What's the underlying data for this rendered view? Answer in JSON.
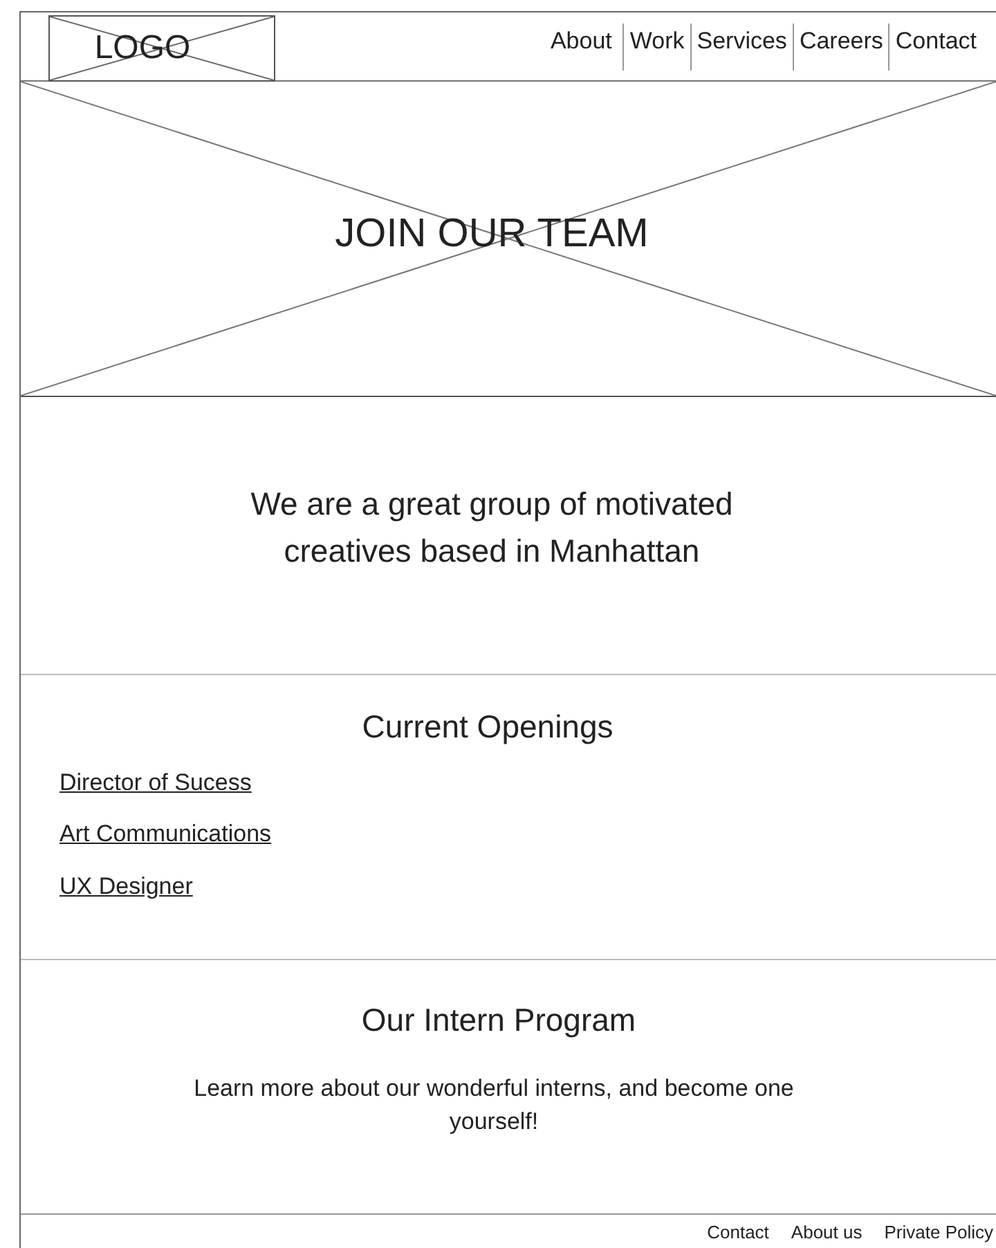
{
  "header": {
    "logo": "LOGO",
    "nav": [
      "About",
      "Work",
      "Services",
      "Careers",
      "Contact"
    ]
  },
  "hero": {
    "title": "JOIN OUR TEAM"
  },
  "intro": {
    "text": "We are a great group of motivated creatives based in Manhattan"
  },
  "openings": {
    "heading": "Current Openings",
    "links": [
      "Director of Sucess",
      "Art Communications",
      "UX Designer"
    ]
  },
  "intern": {
    "heading": "Our Intern Program",
    "text": "Learn more about our wonderful interns, and become one yourself!"
  },
  "footer": {
    "links": [
      "Contact",
      "About us",
      "Private Policy"
    ]
  }
}
